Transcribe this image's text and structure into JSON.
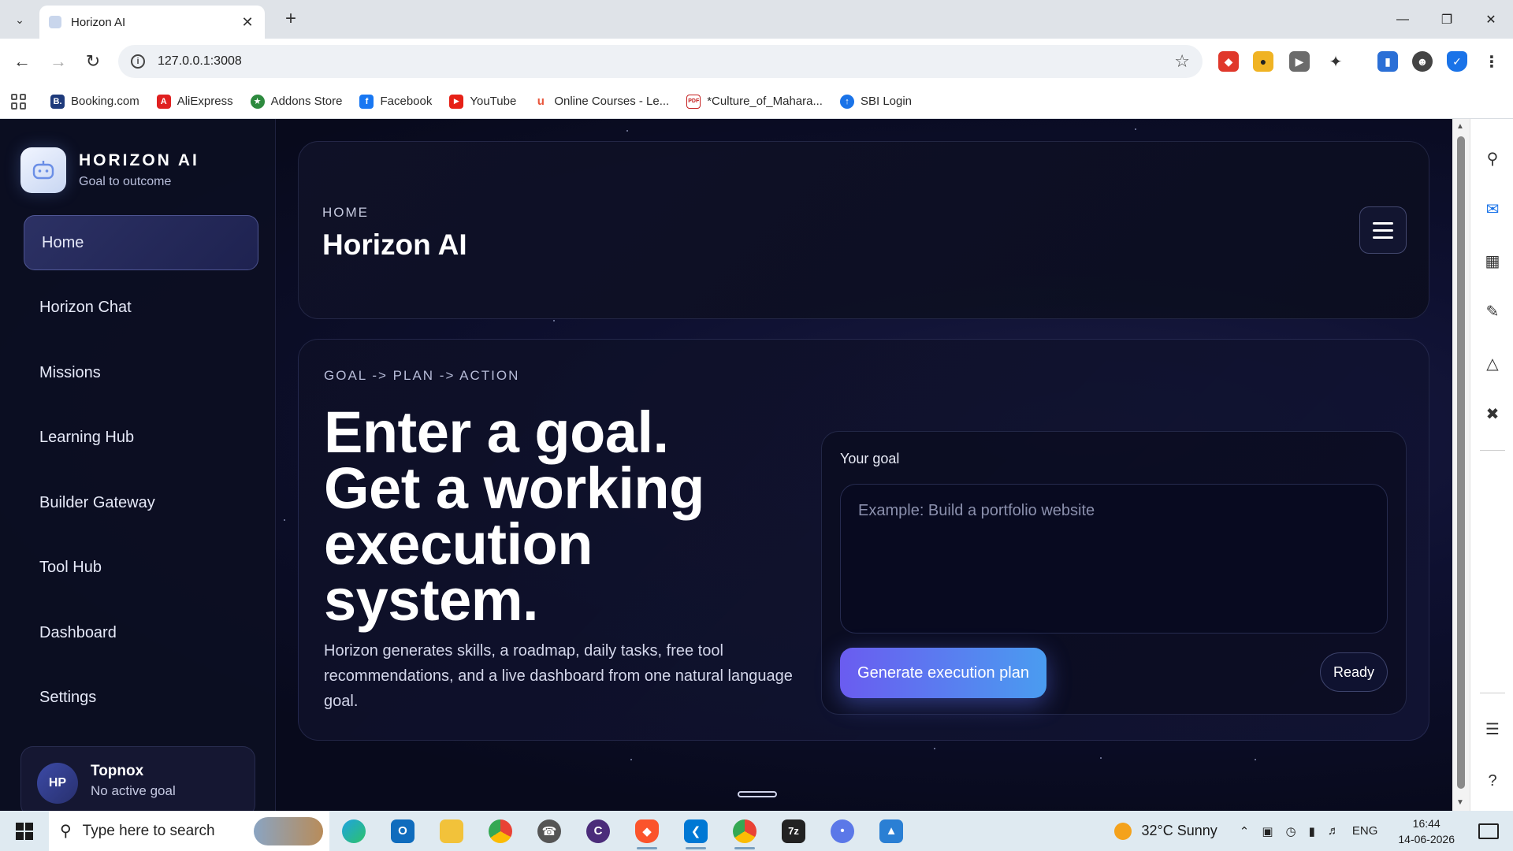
{
  "browser": {
    "tab_title": "Horizon AI",
    "url": "127.0.0.1:3008",
    "bookmarks": [
      {
        "label": "Booking.com",
        "icon": "B.",
        "color": "#1e3a7b"
      },
      {
        "label": "AliExpress",
        "icon": "A",
        "color": "#e02020"
      },
      {
        "label": "Addons Store",
        "icon": "★",
        "color": "#2d8a3e"
      },
      {
        "label": "Facebook",
        "icon": "f",
        "color": "#1877f2"
      },
      {
        "label": "YouTube",
        "icon": "▶",
        "color": "#e62117"
      },
      {
        "label": "Online Courses - Le...",
        "icon": "u",
        "color": "#e8553b"
      },
      {
        "label": "*Culture_of_Mahara...",
        "icon": "PDF",
        "color": "#c41e1e"
      },
      {
        "label": "SBI Login",
        "icon": "↑",
        "color": "#1a73e8"
      }
    ]
  },
  "sidebar": {
    "brand_title": "HORIZON AI",
    "brand_subtitle": "Goal to outcome",
    "items": [
      {
        "label": "Home",
        "active": true
      },
      {
        "label": "Horizon Chat"
      },
      {
        "label": "Missions"
      },
      {
        "label": "Learning Hub"
      },
      {
        "label": "Builder Gateway"
      },
      {
        "label": "Tool Hub"
      },
      {
        "label": "Dashboard"
      },
      {
        "label": "Settings"
      }
    ],
    "user": {
      "initials": "HP",
      "name": "Topnox",
      "status": "No active goal"
    }
  },
  "header": {
    "breadcrumb": "HOME",
    "title": "Horizon AI"
  },
  "hero": {
    "kicker": "GOAL -> PLAN -> ACTION",
    "headline_lines": [
      "Enter a goal.",
      "Get a working",
      "execution",
      "system."
    ],
    "description": "Horizon generates skills, a roadmap, daily tasks, free tool recommendations, and a live dashboard from one natural language goal."
  },
  "goal_form": {
    "label": "Your goal",
    "placeholder": "Example: Build a portfolio website",
    "value": "",
    "generate_label": "Generate execution plan",
    "status": "Ready"
  },
  "taskbar": {
    "search_placeholder": "Type here to search",
    "weather": "32°C  Sunny",
    "language": "ENG",
    "time": "16:44",
    "date": "14-06-2026"
  }
}
